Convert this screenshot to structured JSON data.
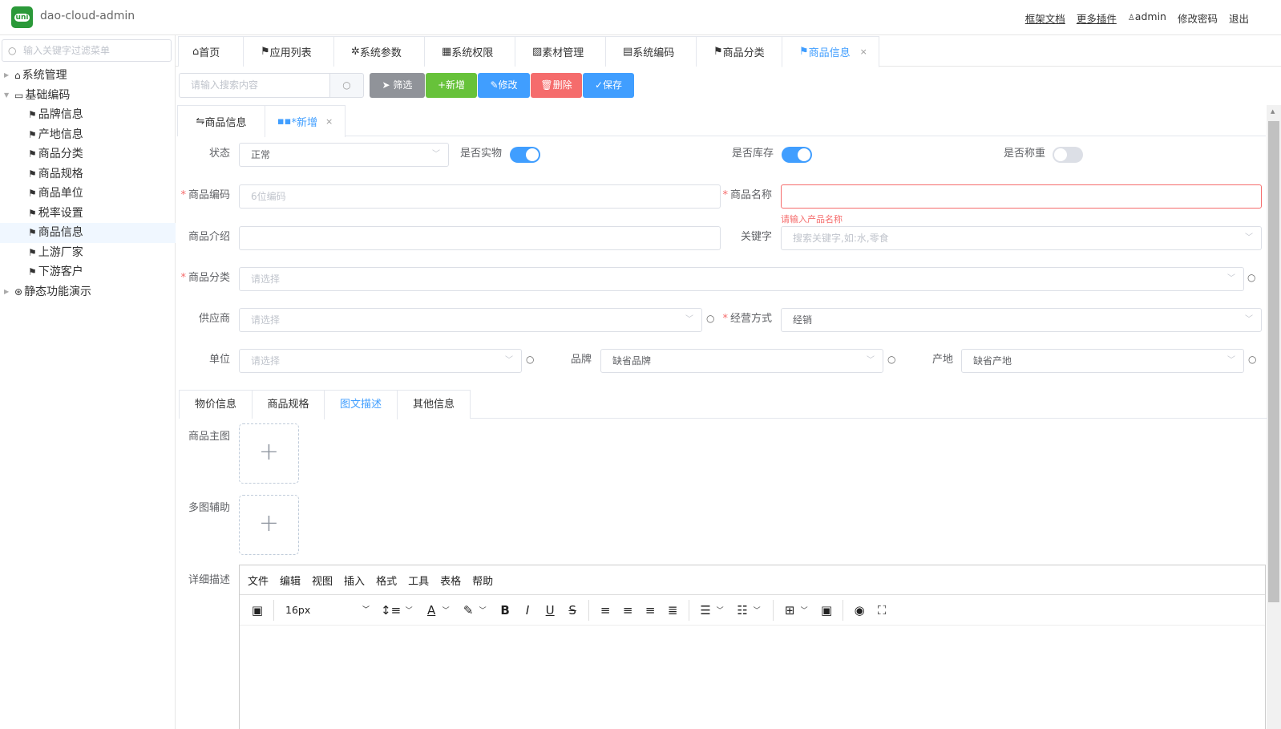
{
  "app": {
    "logo_text": "uni",
    "title": "dao-cloud-admin"
  },
  "topnav": {
    "docs": "框架文档",
    "plugins": "更多插件",
    "user": "admin",
    "change_pwd": "修改密码",
    "logout": "退出"
  },
  "sidebar": {
    "search_placeholder": "输入关键字过滤菜单",
    "items": [
      {
        "label": "系统管理"
      },
      {
        "label": "基础编码"
      },
      {
        "label": "品牌信息"
      },
      {
        "label": "产地信息"
      },
      {
        "label": "商品分类"
      },
      {
        "label": "商品规格"
      },
      {
        "label": "商品单位"
      },
      {
        "label": "税率设置"
      },
      {
        "label": "商品信息"
      },
      {
        "label": "上游厂家"
      },
      {
        "label": "下游客户"
      },
      {
        "label": "静态功能演示"
      }
    ]
  },
  "tabs": [
    {
      "label": "首页"
    },
    {
      "label": "应用列表"
    },
    {
      "label": "系统参数"
    },
    {
      "label": "系统权限"
    },
    {
      "label": "素材管理"
    },
    {
      "label": "系统编码"
    },
    {
      "label": "商品分类"
    },
    {
      "label": "商品信息",
      "close": "×"
    }
  ],
  "toolbar": {
    "search_placeholder": "请输入搜索内容",
    "filter": "筛选",
    "add": "+新增",
    "edit": "修改",
    "delete": "删除",
    "save": "保存",
    "colors": {
      "filter": "#909399",
      "add": "#67c23a",
      "edit": "#409eff",
      "delete": "#f56c6c",
      "save": "#409eff"
    }
  },
  "subtabs": [
    {
      "label": "商品信息"
    },
    {
      "label": "*新增",
      "close": "×"
    }
  ],
  "form": {
    "status": {
      "label": "状态",
      "value": "正常"
    },
    "is_physical": {
      "label": "是否实物",
      "on": true
    },
    "is_stock": {
      "label": "是否库存",
      "on": true
    },
    "is_weigh": {
      "label": "是否称重",
      "on": false
    },
    "code": {
      "label": "商品编码",
      "placeholder": "6位编码"
    },
    "name": {
      "label": "商品名称",
      "error": "请输入产品名称"
    },
    "intro": {
      "label": "商品介绍"
    },
    "keywords": {
      "label": "关键字",
      "placeholder": "搜索关键字,如:水,零食"
    },
    "category": {
      "label": "商品分类",
      "placeholder": "请选择"
    },
    "supplier": {
      "label": "供应商",
      "placeholder": "请选择"
    },
    "biz_mode": {
      "label": "经营方式",
      "value": "经销"
    },
    "unit": {
      "label": "单位",
      "placeholder": "请选择"
    },
    "brand": {
      "label": "品牌",
      "value": "缺省品牌"
    },
    "origin": {
      "label": "产地",
      "value": "缺省产地"
    }
  },
  "panel_tabs": [
    {
      "label": "物价信息"
    },
    {
      "label": "商品规格"
    },
    {
      "label": "图文描述"
    },
    {
      "label": "其他信息"
    }
  ],
  "media": {
    "main_image": "商品主图",
    "multi_image": "多图辅助",
    "detail": "详细描述"
  },
  "editor": {
    "menus": [
      "文件",
      "编辑",
      "视图",
      "插入",
      "格式",
      "工具",
      "表格",
      "帮助"
    ],
    "font_size": "16px"
  }
}
